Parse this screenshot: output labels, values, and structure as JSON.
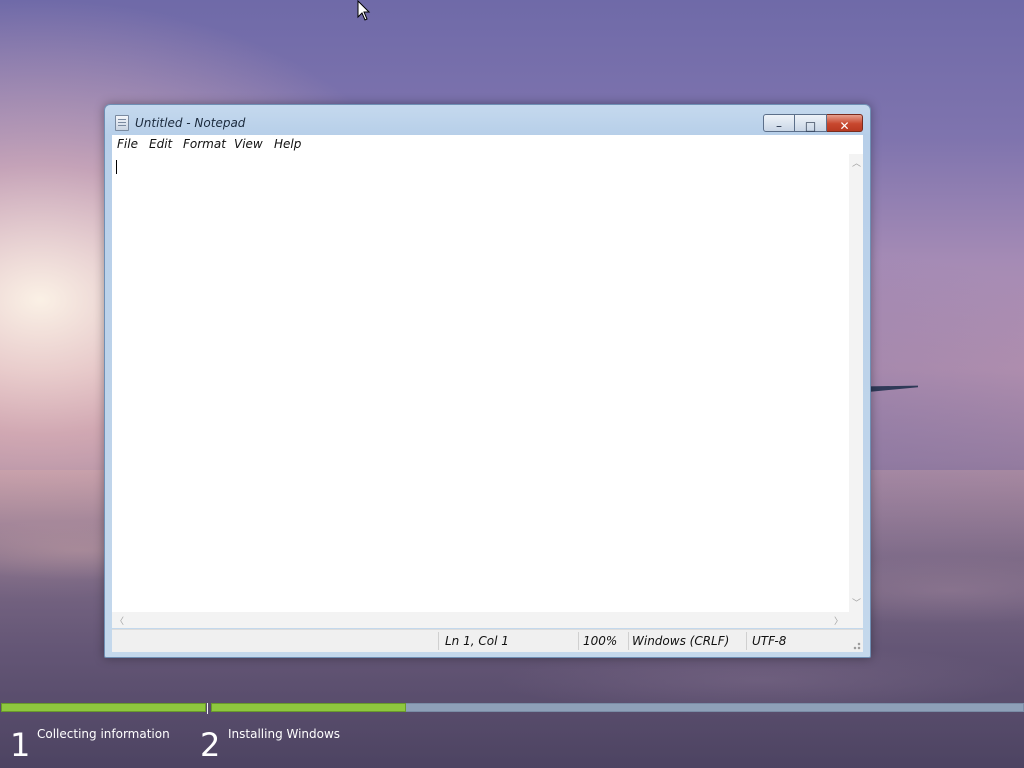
{
  "window": {
    "title": "Untitled - Notepad",
    "minimize_glyph": "–",
    "maximize_glyph": "□",
    "close_glyph": "✕"
  },
  "menu": {
    "items": [
      "File",
      "Edit",
      "Format",
      "View",
      "Help"
    ]
  },
  "editor": {
    "content": ""
  },
  "statusbar": {
    "position": "Ln 1, Col 1",
    "zoom": "100%",
    "line_endings": "Windows (CRLF)",
    "encoding": "UTF-8"
  },
  "setup": {
    "steps": [
      {
        "number": "1",
        "label": "Collecting information",
        "progress": 1.0
      },
      {
        "number": "2",
        "label": "Installing Windows",
        "progress": 0.24
      }
    ],
    "colors": {
      "done": "#8ec73e",
      "pending": "#8ea0b8"
    }
  },
  "icons": {
    "app": "notepad-icon",
    "cursor": "arrow-cursor-icon"
  }
}
